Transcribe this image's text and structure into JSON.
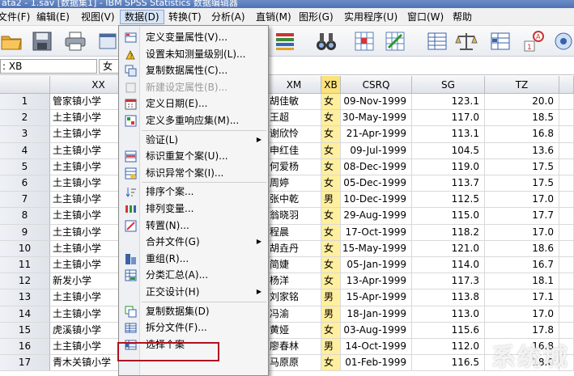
{
  "window": {
    "title": "ata2 - 1.sav [数据集1] - IBM SPSS Statistics 数据编辑器"
  },
  "menubar": {
    "items": [
      "文件(F)",
      "编辑(E)",
      "视图(V)",
      "数据(D)",
      "转换(T)",
      "分析(A)",
      "直销(M)",
      "图形(G)",
      "实用程序(U)",
      "窗口(W)",
      "帮助"
    ]
  },
  "editbar": {
    "cell_ref": ": XB",
    "cell_value": "女"
  },
  "grid": {
    "headers": {
      "xx": "XX",
      "xm": "XM",
      "xb": "XB",
      "csrq": "CSRQ",
      "sg": "SG",
      "tz": "TZ"
    },
    "rows": [
      {
        "n": "1",
        "xx": "管家镇小学",
        "xm": "胡佳敏",
        "xb": "女",
        "csrq": "09-Nov-1999",
        "sg": "123.1",
        "tz": "20.0"
      },
      {
        "n": "2",
        "xx": "土主镇小学",
        "xm": "王超",
        "xb": "女",
        "csrq": "30-May-1999",
        "sg": "117.0",
        "tz": "18.5"
      },
      {
        "n": "3",
        "xx": "土主镇小学",
        "xm": "谢欣怜",
        "xb": "女",
        "csrq": "21-Apr-1999",
        "sg": "113.1",
        "tz": "16.8"
      },
      {
        "n": "4",
        "xx": "土主镇小学",
        "xm": "申红佳",
        "xb": "女",
        "csrq": "09-Jul-1999",
        "sg": "104.5",
        "tz": "13.6"
      },
      {
        "n": "5",
        "xx": "土主镇小学",
        "xm": "何爱杨",
        "xb": "女",
        "csrq": "08-Dec-1999",
        "sg": "119.0",
        "tz": "17.5"
      },
      {
        "n": "6",
        "xx": "土主镇小学",
        "xm": "周婷",
        "xb": "女",
        "csrq": "05-Dec-1999",
        "sg": "113.7",
        "tz": "17.5"
      },
      {
        "n": "7",
        "xx": "土主镇小学",
        "xm": "张中乾",
        "xb": "男",
        "csrq": "10-Dec-1999",
        "sg": "112.5",
        "tz": "17.0"
      },
      {
        "n": "8",
        "xx": "土主镇小学",
        "xm": "翁晓羽",
        "xb": "女",
        "csrq": "29-Aug-1999",
        "sg": "115.0",
        "tz": "17.7"
      },
      {
        "n": "9",
        "xx": "土主镇小学",
        "xm": "程晨",
        "xb": "女",
        "csrq": "17-Oct-1999",
        "sg": "118.2",
        "tz": "17.0"
      },
      {
        "n": "10",
        "xx": "土主镇小学",
        "xm": "胡垚丹",
        "xb": "女",
        "csrq": "15-May-1999",
        "sg": "121.0",
        "tz": "18.6"
      },
      {
        "n": "11",
        "xx": "土主镇小学",
        "xm": "简婕",
        "xb": "女",
        "csrq": "05-Jan-1999",
        "sg": "114.0",
        "tz": "16.7"
      },
      {
        "n": "12",
        "xx": "新发小学",
        "xm": "杨洋",
        "xb": "女",
        "csrq": "13-Apr-1999",
        "sg": "117.3",
        "tz": "18.1"
      },
      {
        "n": "13",
        "xx": "土主镇小学",
        "xm": "刘家铭",
        "xb": "男",
        "csrq": "15-Apr-1999",
        "sg": "113.8",
        "tz": "17.1"
      },
      {
        "n": "14",
        "xx": "土主镇小学",
        "xm": "冯渝",
        "xb": "男",
        "csrq": "18-Jan-1999",
        "sg": "113.0",
        "tz": "17.0"
      },
      {
        "n": "15",
        "xx": "虎溪镇小学",
        "xm": "黄娅",
        "xb": "女",
        "csrq": "03-Aug-1999",
        "sg": "115.6",
        "tz": "17.8"
      },
      {
        "n": "16",
        "xx": "土主镇小学",
        "xm": "廖春林",
        "xb": "男",
        "csrq": "14-Oct-1999",
        "sg": "112.0",
        "tz": "16.8"
      },
      {
        "n": "17",
        "xx": "青木关镇小学",
        "xm": "马原原",
        "xb": "女",
        "csrq": "01-Feb-1999",
        "sg": "116.5",
        "tz": "18.0"
      }
    ]
  },
  "data_menu": {
    "items": [
      {
        "label": "定义变量属性(V)...",
        "icon": "define-properties-icon"
      },
      {
        "label": "设置未知测量级别(L)...",
        "icon": "measure-level-icon"
      },
      {
        "label": "复制数据属性(C)...",
        "icon": "copy-properties-icon"
      },
      {
        "label": "新建设定属性(B)...",
        "icon": "custom-attribute-icon",
        "disabled": true
      },
      {
        "label": "定义日期(E)...",
        "icon": "calendar-icon"
      },
      {
        "label": "定义多重响应集(M)...",
        "icon": "multiple-response-icon"
      },
      {
        "label": "验证(L)",
        "submenu": true
      },
      {
        "label": "标识重复个案(U)...",
        "icon": "duplicate-cases-icon"
      },
      {
        "label": "标识异常个案(I)...",
        "icon": "unusual-cases-icon"
      },
      {
        "label": "排序个案...",
        "icon": "sort-cases-icon"
      },
      {
        "label": "排列变量...",
        "icon": "sort-variables-icon"
      },
      {
        "label": "转置(N)...",
        "icon": "transpose-icon"
      },
      {
        "label": "合并文件(G)",
        "submenu": true
      },
      {
        "label": "重组(R)...",
        "icon": "restructure-icon"
      },
      {
        "label": "分类汇总(A)...",
        "icon": "aggregate-icon"
      },
      {
        "label": "正交设计(H)",
        "submenu": true
      },
      {
        "label": "复制数据集(D)",
        "icon": "copy-dataset-icon"
      },
      {
        "label": "拆分文件(F)...",
        "icon": "split-file-icon"
      },
      {
        "label": "选择个案",
        "icon": "select-cases-icon"
      }
    ]
  },
  "watermark": "系统城"
}
